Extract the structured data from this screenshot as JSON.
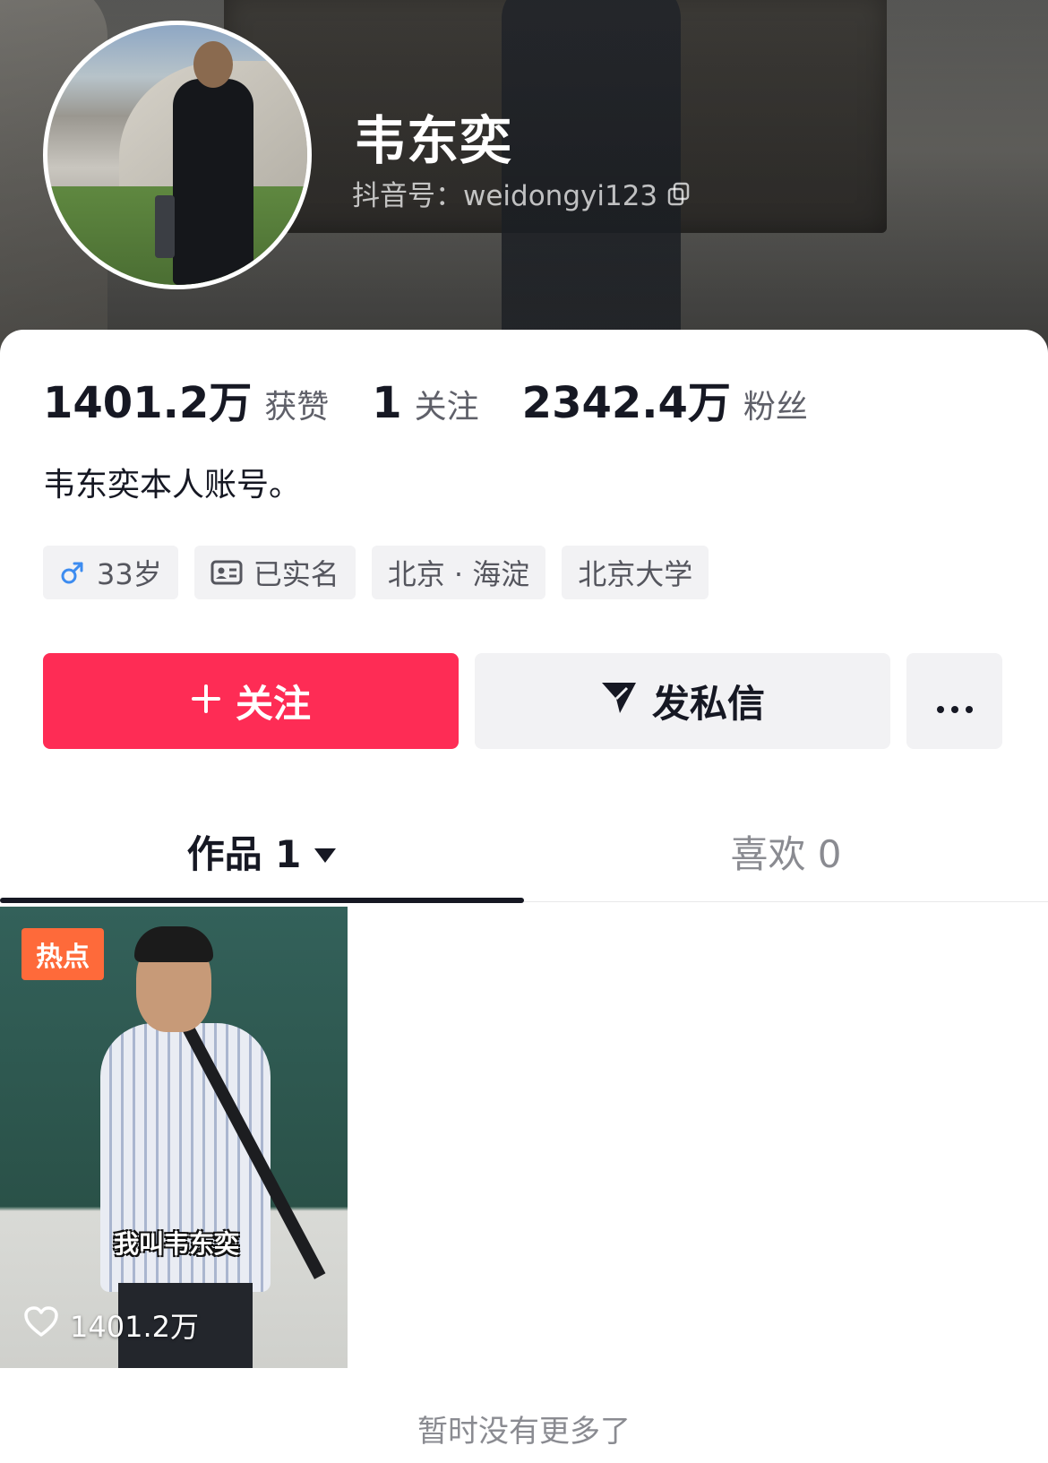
{
  "profile": {
    "name": "韦东奕",
    "douyin_id": "抖音号：weidongyi123"
  },
  "stats": {
    "likes": {
      "value": "1401.2万",
      "label": "获赞"
    },
    "following": {
      "value": "1",
      "label": "关注"
    },
    "followers": {
      "value": "2342.4万",
      "label": "粉丝"
    }
  },
  "bio": "韦东奕本人账号。",
  "tags": {
    "age": "33岁",
    "verified": "已实名",
    "location": "北京 · 海淀",
    "school": "北京大学"
  },
  "actions": {
    "follow_label": "关注",
    "message_label": "发私信"
  },
  "tabs": {
    "works_label": "作品 1",
    "likes_label": "喜欢 0"
  },
  "video": {
    "badge": "热点",
    "caption": "我叫韦东奕",
    "likes": "1401.2万"
  },
  "footer": "暂时没有更多了",
  "colors": {
    "accent": "#fe2c55",
    "hot_badge": "#fe6a3a",
    "male_icon": "#3d8cf0"
  }
}
